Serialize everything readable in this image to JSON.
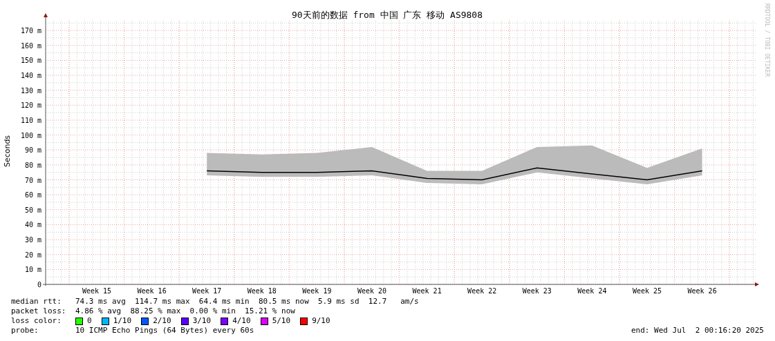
{
  "chart": {
    "chart_data": {
      "type": "line",
      "title": "90天前的数据 from 中国 广东 移动 AS9808",
      "ylabel": "Seconds",
      "categories": [
        "Week 15",
        "Week 16",
        "Week 17",
        "Week 18",
        "Week 19",
        "Week 20",
        "Week 21",
        "Week 22",
        "Week 23",
        "Week 24",
        "Week 25",
        "Week 26"
      ],
      "series": [
        {
          "type": "area",
          "color": "#bbbbbb",
          "values": [
            null,
            null,
            88,
            87,
            88,
            92,
            76,
            76,
            92,
            93,
            78,
            91
          ]
        },
        {
          "color": "#000000",
          "values": [
            null,
            null,
            76,
            75,
            75,
            76,
            71,
            70,
            78,
            74,
            70,
            76
          ]
        }
      ],
      "ylim": [
        0,
        177
      ],
      "grid": true,
      "yticks": [
        {
          "value": 0,
          "label": "0"
        },
        {
          "value": 10,
          "label": "10 m"
        },
        {
          "value": 20,
          "label": "20 m"
        },
        {
          "value": 30,
          "label": "30 m"
        },
        {
          "value": 40,
          "label": "40 m"
        },
        {
          "value": 50,
          "label": "50 m"
        },
        {
          "value": 60,
          "label": "60 m"
        },
        {
          "value": 70,
          "label": "70 m"
        },
        {
          "value": 80,
          "label": "80 m"
        },
        {
          "value": 90,
          "label": "90 m"
        },
        {
          "value": 100,
          "label": "100 m"
        },
        {
          "value": 110,
          "label": "110 m"
        },
        {
          "value": 120,
          "label": "120 m"
        },
        {
          "value": 130,
          "label": "130 m"
        },
        {
          "value": 140,
          "label": "140 m"
        },
        {
          "value": 150,
          "label": "150 m"
        },
        {
          "value": 160,
          "label": "160 m"
        },
        {
          "value": 170,
          "label": "170 m"
        }
      ]
    },
    "credit": "RRDTOOL / TOBI OETIKER"
  },
  "legend": {
    "median_rtt": {
      "label": "median rtt:",
      "text": "74.3 ms avg  114.7 ms max  64.4 ms min  80.5 ms now  5.9 ms sd  12.7   am/s"
    },
    "packet_loss": {
      "label": "packet loss:",
      "text": "4.86 % avg  88.25 % max  0.00 % min  15.21 % now"
    },
    "loss_color": {
      "label": "loss color:",
      "items": [
        {
          "label": "0",
          "color": "#26ff00"
        },
        {
          "label": "1/10",
          "color": "#00b8ff"
        },
        {
          "label": "2/10",
          "color": "#0059ff"
        },
        {
          "label": "3/10",
          "color": "#5e00ff"
        },
        {
          "label": "4/10",
          "color": "#7e00ff"
        },
        {
          "label": "5/10",
          "color": "#dd00ff"
        },
        {
          "label": "9/10",
          "color": "#ff0000"
        }
      ]
    },
    "probe": {
      "label": "probe:",
      "text": "10 ICMP Echo Pings (64 Bytes) every 60s"
    },
    "end": "end: Wed Jul  2 00:16:20 2025"
  }
}
